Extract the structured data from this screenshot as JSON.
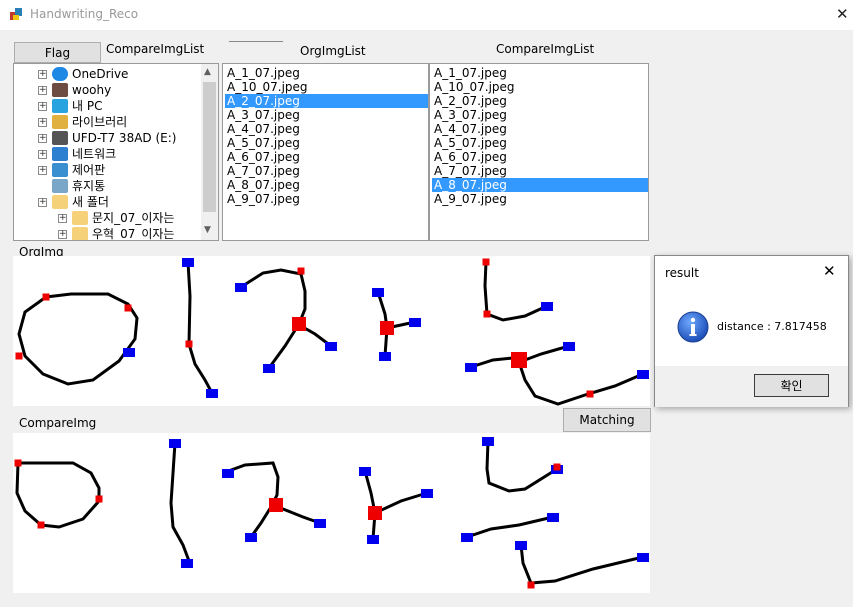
{
  "window": {
    "title": "Handwriting_Reco",
    "close_glyph": "✕"
  },
  "toolbar": {
    "flag_button": "Flag",
    "compare_label_left": "CompareImgList",
    "org_label": "OrgImgList",
    "compare_label_right": "CompareImgList",
    "matching_button": "Matching"
  },
  "tree": {
    "items": [
      {
        "label": "OneDrive",
        "icon": "cloud-icon"
      },
      {
        "label": "woohy",
        "icon": "user-icon"
      },
      {
        "label": "내 PC",
        "icon": "pc-icon"
      },
      {
        "label": "라이브러리",
        "icon": "library-icon"
      },
      {
        "label": "UFD-T7 38AD (E:)",
        "icon": "usb-drive-icon"
      },
      {
        "label": "네트워크",
        "icon": "network-icon"
      },
      {
        "label": "제어판",
        "icon": "control-panel-icon"
      },
      {
        "label": "휴지통",
        "icon": "recycle-bin-icon"
      },
      {
        "label": "새 폴더",
        "icon": "folder-icon"
      },
      {
        "label": "문지_07_이자는",
        "icon": "folder-icon"
      },
      {
        "label": "우혁_07_이자는",
        "icon": "folder-icon"
      }
    ]
  },
  "org_list": {
    "items": [
      "A_1_07.jpeg",
      "A_10_07.jpeg",
      "A_2_07.jpeg",
      "A_3_07.jpeg",
      "A_4_07.jpeg",
      "A_5_07.jpeg",
      "A_6_07.jpeg",
      "A_7_07.jpeg",
      "A_8_07.jpeg",
      "A_9_07.jpeg"
    ],
    "selected": "A_2_07.jpeg"
  },
  "compare_list": {
    "items": [
      "A_1_07.jpeg",
      "A_10_07.jpeg",
      "A_2_07.jpeg",
      "A_3_07.jpeg",
      "A_4_07.jpeg",
      "A_5_07.jpeg",
      "A_6_07.jpeg",
      "A_7_07.jpeg",
      "A_8_07.jpeg",
      "A_9_07.jpeg"
    ],
    "selected": "A_8_07.jpeg"
  },
  "panels": {
    "org_title": "OrgImg",
    "compare_title": "CompareImg"
  },
  "dialog": {
    "title": "result",
    "message": "distance : 7.817458",
    "ok_button": "확인",
    "close_glyph": "✕"
  },
  "colors": {
    "selection": "#3399ff",
    "stroke": "#000000",
    "endpoint": "#0000ee",
    "junction": "#ee0000"
  }
}
